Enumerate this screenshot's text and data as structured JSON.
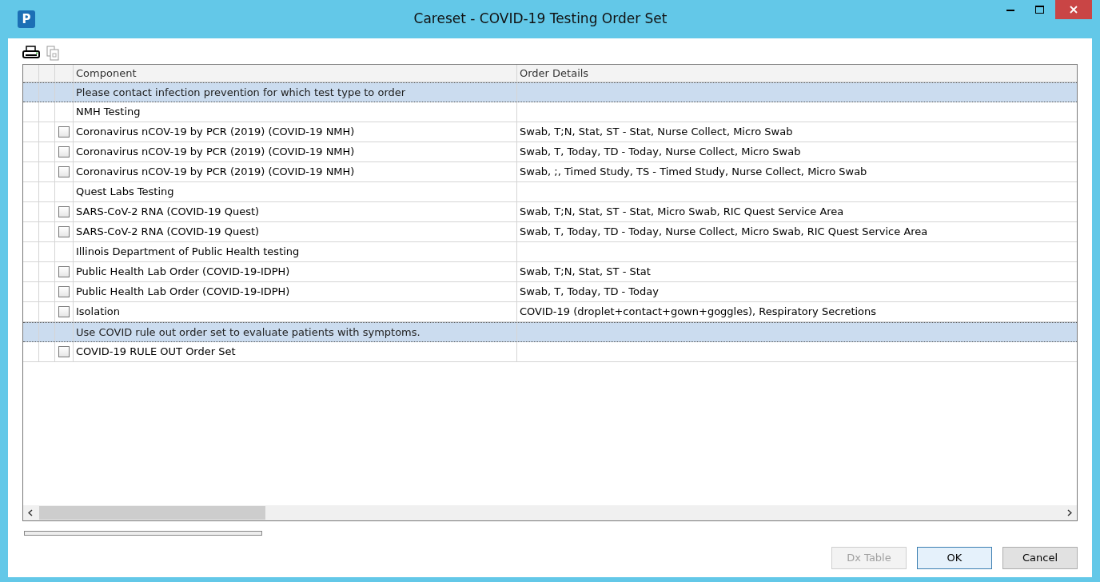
{
  "window": {
    "title": "Careset - COVID-19 Testing Order Set",
    "app_letter": "P"
  },
  "table": {
    "columns": [
      "Component",
      "Order Details"
    ],
    "rows": [
      {
        "kind": "note",
        "component": "Please contact infection prevention for which test type to order"
      },
      {
        "kind": "header",
        "component": "NMH Testing"
      },
      {
        "kind": "order",
        "checked": false,
        "component": "Coronavirus nCOV-19 by PCR (2019) (COVID-19 NMH)",
        "details": "Swab, T;N, Stat, ST - Stat, Nurse Collect, Micro Swab"
      },
      {
        "kind": "order",
        "checked": false,
        "component": "Coronavirus nCOV-19 by PCR (2019) (COVID-19 NMH)",
        "details": "Swab, T, Today, TD - Today, Nurse Collect, Micro Swab"
      },
      {
        "kind": "order",
        "checked": false,
        "component": "Coronavirus nCOV-19 by PCR (2019) (COVID-19 NMH)",
        "details": "Swab, ;, Timed Study, TS - Timed Study, Nurse Collect, Micro Swab"
      },
      {
        "kind": "header",
        "component": "Quest Labs Testing"
      },
      {
        "kind": "order",
        "checked": false,
        "component": "SARS-CoV-2 RNA (COVID-19 Quest)",
        "details": "Swab, T;N, Stat, ST - Stat, Micro Swab, RIC Quest Service Area"
      },
      {
        "kind": "order",
        "checked": false,
        "component": "SARS-CoV-2 RNA (COVID-19 Quest)",
        "details": "Swab, T, Today, TD - Today, Nurse Collect, Micro Swab, RIC Quest Service Area"
      },
      {
        "kind": "header",
        "component": "Illinois Department of Public Health testing"
      },
      {
        "kind": "order",
        "checked": false,
        "component": "Public Health Lab Order (COVID-19-IDPH)",
        "details": "Swab, T;N, Stat, ST - Stat"
      },
      {
        "kind": "order",
        "checked": false,
        "component": "Public Health Lab Order (COVID-19-IDPH)",
        "details": "Swab, T, Today, TD - Today"
      },
      {
        "kind": "order",
        "checked": false,
        "component": "Isolation",
        "details": "COVID-19 (droplet+contact+gown+goggles), Respiratory Secretions"
      },
      {
        "kind": "note",
        "component": "Use COVID rule out order set to evaluate patients with symptoms."
      },
      {
        "kind": "order",
        "checked": false,
        "component": "COVID-19 RULE OUT Order Set"
      }
    ]
  },
  "buttons": [
    {
      "label": "Dx Table",
      "disabled": true
    },
    {
      "label": "OK",
      "disabled": false
    },
    {
      "label": "Cancel",
      "disabled": false
    }
  ]
}
